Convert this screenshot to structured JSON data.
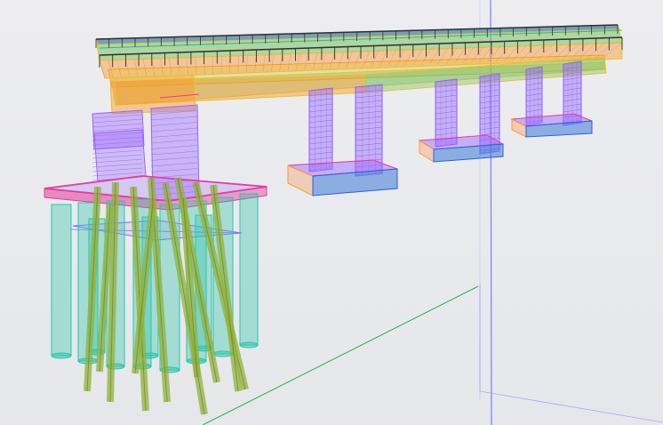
{
  "viewport": {
    "background": "#e9ebed",
    "grid_colors": {
      "green": "#26b34a",
      "blue": "#7e7cff"
    }
  },
  "model": {
    "colors": {
      "deck_yellow": "#e6c12f",
      "deck_orange": "#ff9a24",
      "deck_green": "#7cc45f",
      "deck_blue": "#2f5fd8",
      "rebar_purple": "#9a63ff",
      "rebar_pink": "#cc3ab3",
      "cap_pink": "#e53b9f",
      "pile_teal": "#29c6aa",
      "pile_olive": "#93b13b",
      "footing_salmon": "#f4b18c",
      "footing_blue": "#3a7bd7",
      "rail_dark": "#2f2f2f",
      "rail_teal": "#27b7a5"
    }
  }
}
